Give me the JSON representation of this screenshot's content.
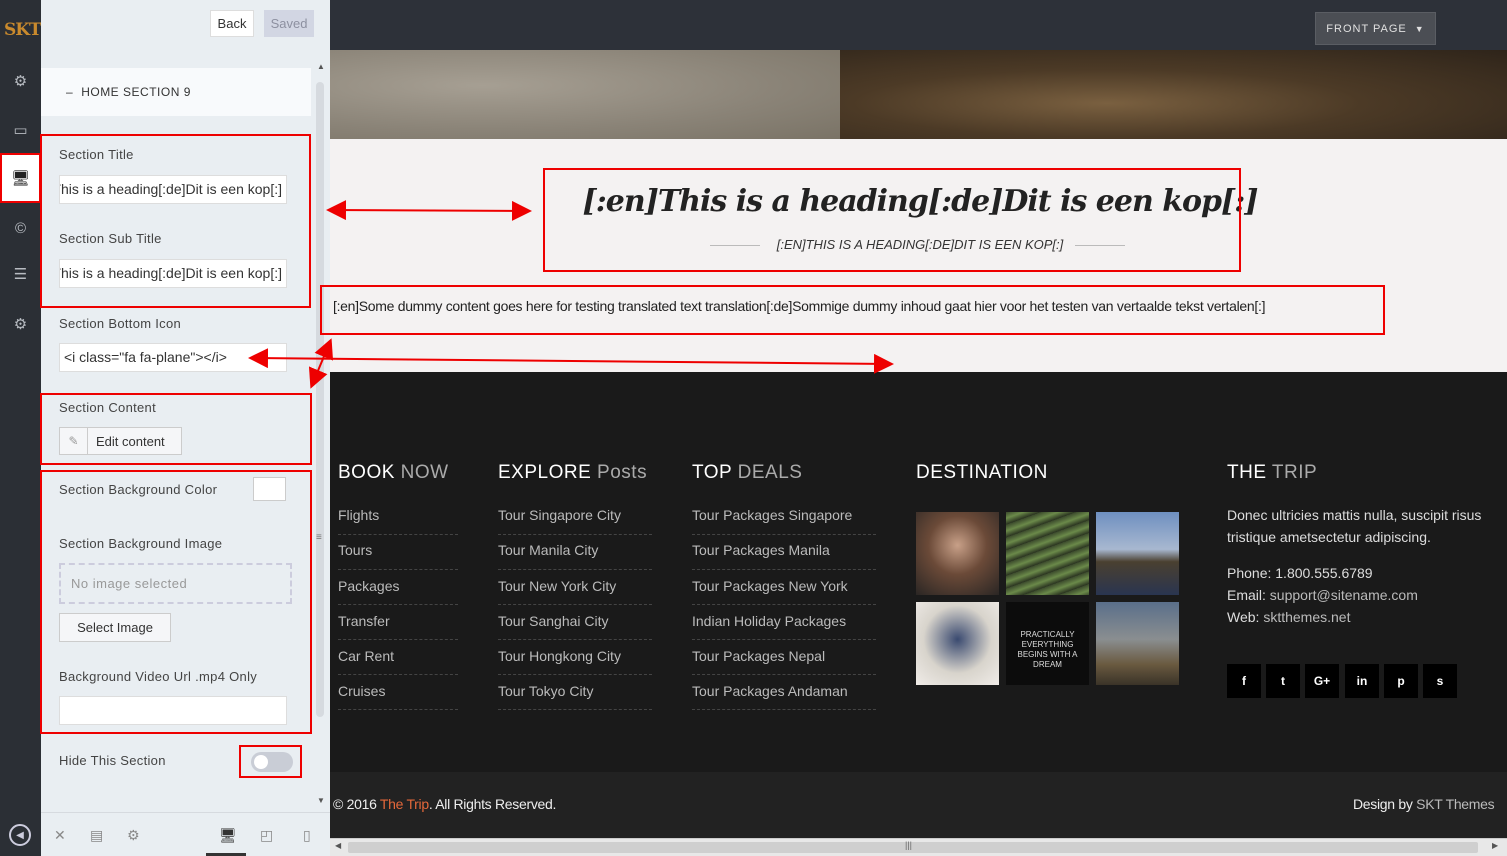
{
  "rail": {
    "logo": "SKT",
    "items": [
      "gear-icon",
      "card-icon",
      "monitor-icon",
      "copyright-icon",
      "list-icon",
      "gear-icon"
    ]
  },
  "panel": {
    "back_label": "Back",
    "saved_label": "Saved",
    "section_heading": "HOME SECTION 9",
    "section_title_label": "Section Title",
    "section_title_value": "[:en]This is a heading[:de]Dit is een kop[:]",
    "section_subtitle_label": "Section Sub Title",
    "section_subtitle_value": "[:en]This is a heading[:de]Dit is een kop[:]",
    "bottom_icon_label": "Section Bottom Icon",
    "bottom_icon_value": "<i class=\"fa fa-plane\"></i>",
    "content_label": "Section Content",
    "edit_content_label": "Edit content",
    "bg_color_label": "Section Background Color",
    "bg_image_label": "Section Background Image",
    "no_image_label": "No image selected",
    "select_image_label": "Select Image",
    "video_url_label": "Background Video Url .mp4 Only",
    "video_url_value": "",
    "hide_label": "Hide This Section",
    "hide_enabled": false
  },
  "preview": {
    "front_page_label": "FRONT PAGE",
    "heading": "[:en]This is a heading[:de]Dit is een kop[:]",
    "subheading": "[:EN]THIS IS A HEADING[:DE]DIT IS EEN KOP[:]",
    "content": "[:en]Some dummy content goes here for testing translated text translation[:de]Sommige dummy inhoud gaat hier voor het testen van vertaalde tekst vertalen[:]",
    "footer": {
      "book": {
        "title_a": "BOOK",
        "title_b": " NOW",
        "links": [
          "Flights",
          "Tours",
          "Packages",
          "Transfer",
          "Car Rent",
          "Cruises"
        ]
      },
      "explore": {
        "title_a": "EXPLORE",
        "title_b": " Posts",
        "links": [
          "Tour Singapore City",
          "Tour Manila City",
          "Tour New York City",
          "Tour Sanghai City",
          "Tour Hongkong City",
          "Tour Tokyo City"
        ]
      },
      "deals": {
        "title_a": "TOP",
        "title_b": " DEALS",
        "links": [
          "Tour Packages Singapore",
          "Tour Packages Manila",
          "Tour Packages New York",
          "Indian Holiday Packages",
          "Tour Packages Nepal",
          "Tour Packages Andaman"
        ]
      },
      "destination": {
        "title": "DESTINATION",
        "thumb_text": "PRACTICALLY EVERYTHING BEGINS WITH A DREAM"
      },
      "trip": {
        "title_a": "THE",
        "title_b": " TRIP",
        "desc_1": "Donec ultricies mattis nulla, suscipit risus",
        "desc_2": "tristique ametsectetur adipiscing.",
        "phone_label": "Phone:",
        "phone": "1.800.555.6789",
        "email_label": "Email:",
        "email": "support@sitename.com",
        "web_label": "Web:",
        "web": "sktthemes.net",
        "social": [
          "f",
          "t",
          "G+",
          "in",
          "p",
          "s"
        ]
      }
    },
    "copyright_a": "© 2016 ",
    "copyright_brand": "The Trip",
    "copyright_b": ". All Rights Reserved.",
    "design_a": "Design by ",
    "design_brand": "SKT Themes"
  }
}
